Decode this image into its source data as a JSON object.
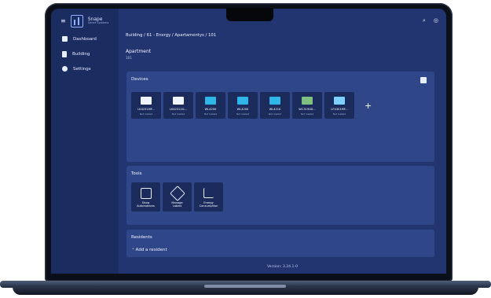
{
  "header": {
    "breadcrumb": "Building / 61 - Energy / Apartamentys / 101",
    "page_title": "Apartment",
    "page_subtitle": "101",
    "actions": [
      "search-icon",
      "account-icon"
    ]
  },
  "brand": {
    "name": "Snape",
    "tagline": "Smart Systems"
  },
  "sidebar": {
    "items": [
      {
        "label": "Dashboard",
        "icon": "grid-icon"
      },
      {
        "label": "Building",
        "icon": "building-icon"
      },
      {
        "label": "Settings",
        "icon": "gear-icon"
      }
    ]
  },
  "devices": {
    "title": "Devices",
    "items": [
      {
        "name": "LK4231MF...",
        "status": "Not loaded",
        "icon": "valve-alert-icon",
        "accent": "#f0f4ff"
      },
      {
        "name": "LK42312G...",
        "status": "Not loaded",
        "icon": "valve-icon",
        "accent": "#f0f4ff"
      },
      {
        "name": "WL4200",
        "status": "Not loaded",
        "icon": "meter-icon",
        "accent": "#2fb5e8"
      },
      {
        "name": "WL4200",
        "status": "Not loaded",
        "icon": "meter-alert-icon",
        "accent": "#2fb5e8"
      },
      {
        "name": "WL4210",
        "status": "Not loaded",
        "icon": "meter-icon",
        "accent": "#2fb5e8"
      },
      {
        "name": "WC3190D...",
        "status": "Not loaded",
        "icon": "display-icon",
        "accent": "#7fbf7f"
      },
      {
        "name": "LF4301MF...",
        "status": "Not loaded",
        "icon": "sensor-icon",
        "accent": "#7fcfff"
      }
    ],
    "add_label": "+"
  },
  "tools": {
    "title": "Tools",
    "items": [
      {
        "label": "Show\nAutomations",
        "icon": "automation-icon"
      },
      {
        "label": "Manage\nLabels",
        "icon": "tags-icon"
      },
      {
        "label": "Energy\nConsumption",
        "icon": "energy-chart-icon"
      }
    ]
  },
  "residents": {
    "title": "Residents",
    "add_label": "Add a resident"
  },
  "footer": {
    "version": "Version: 3.24.1-0"
  }
}
